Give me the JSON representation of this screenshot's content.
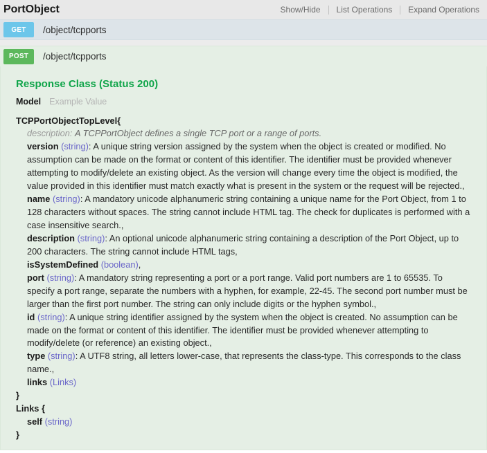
{
  "resource": {
    "title": "PortObject",
    "options": [
      {
        "label": "Show/Hide",
        "name": "show-hide"
      },
      {
        "label": "List Operations",
        "name": "list-operations"
      },
      {
        "label": "Expand Operations",
        "name": "expand-operations"
      }
    ]
  },
  "operations": [
    {
      "method": "GET",
      "path": "/object/tcpports",
      "method_color": "#6cc6ea",
      "row_color": "#dde4e9"
    },
    {
      "method": "POST",
      "path": "/object/tcpports",
      "method_color": "#5cb85c",
      "row_color": "#e5efe5"
    }
  ],
  "response_class": {
    "heading": "Response Class (Status 200)",
    "heading_color": "#10a54a",
    "tabs": [
      {
        "label": "Model",
        "active": true
      },
      {
        "label": "Example Value",
        "active": false
      }
    ]
  },
  "model": {
    "root_name": "TCPPortObjectTopLevel",
    "open_brace": "{",
    "close_brace": "}",
    "description_label": "description:",
    "description_text": "A TCPPortObject defines a single TCP port or a range of ports.",
    "properties": [
      {
        "name": "version",
        "type": "(string)",
        "separator": ": ",
        "description": "A unique string version assigned by the system when the object is created or modified. No assumption can be made on the format or content of this identifier. The identifier must be provided whenever attempting to modify/delete an existing object. As the version will change every time the object is modified, the value provided in this identifier must match exactly what is present in the system or the request will be rejected.,"
      },
      {
        "name": "name",
        "type": "(string)",
        "separator": ": ",
        "description": "A mandatory unicode alphanumeric string containing a unique name for the Port Object, from 1 to 128 characters without spaces. The string cannot include HTML tag. The check for duplicates is performed with a case insensitive search.,"
      },
      {
        "name": "description",
        "type": "(string)",
        "separator": ": ",
        "description": "An optional unicode alphanumeric string containing a description of the Port Object, up to 200 characters. The string cannot include HTML tags,"
      },
      {
        "name": "isSystemDefined",
        "type": "(boolean)",
        "separator": "",
        "description": ","
      },
      {
        "name": "port",
        "type": "(string)",
        "separator": ": ",
        "description": "A mandatory string representing a port or a port range. Valid port numbers are 1 to 65535. To specify a port range, separate the numbers with a hyphen, for example, 22-45. The second port number must be larger than the first port number. The string can only include digits or the hyphen symbol.,"
      },
      {
        "name": "id",
        "type": "(string)",
        "separator": ": ",
        "description": "A unique string identifier assigned by the system when the object is created. No assumption can be made on the format or content of this identifier. The identifier must be provided whenever attempting to modify/delete (or reference) an existing object.,"
      },
      {
        "name": "type",
        "type": "(string)",
        "separator": ": ",
        "description": "A UTF8 string, all letters lower-case, that represents the class-type. This corresponds to the class name.,"
      },
      {
        "name": "links",
        "type": "(Links)",
        "separator": "",
        "description": ""
      }
    ]
  },
  "links_model": {
    "root_name": "Links",
    "open_brace": "{",
    "close_brace": "}",
    "properties": [
      {
        "name": "self",
        "type": "(string)",
        "separator": "",
        "description": ""
      }
    ]
  },
  "colors": {
    "type_link": "#6a66c9",
    "get_badge": "#6cc6ea",
    "post_badge": "#5cb85c",
    "accent_green": "#10a54a",
    "header_bg": "#e8e8e8"
  }
}
